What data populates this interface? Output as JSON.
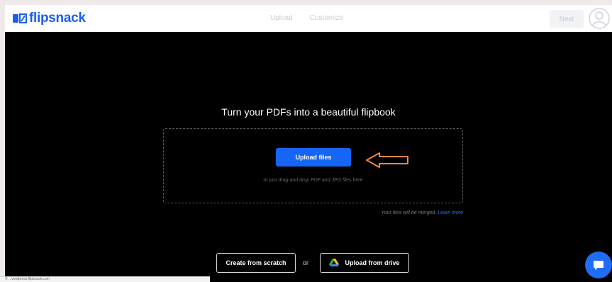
{
  "header": {
    "logo_text": "flipsnack",
    "nav": [
      {
        "label": "Upload"
      },
      {
        "label": "Customize"
      }
    ],
    "next_label": "Next"
  },
  "main": {
    "title": "Turn your PDFs into a beautiful flipbook",
    "upload_button": "Upload files",
    "drop_hint": "or just drag and drop PDF and JPG files here",
    "merge_note": "Your files will be merged.",
    "learn_more": "Learn more"
  },
  "footer": {
    "create_scratch": "Create from scratch",
    "or": "or",
    "upload_drive": "Upload from drive"
  },
  "status_bar": "© ...vordpress.flipsnack.com",
  "colors": {
    "brand_blue": "#1a5ef0",
    "button_blue": "#1565f6",
    "annotation_arrow": "#f0883e"
  },
  "icons": [
    "flipsnack-logo-icon",
    "avatar-icon",
    "arrow-annotation-icon",
    "google-drive-icon",
    "chat-icon"
  ]
}
